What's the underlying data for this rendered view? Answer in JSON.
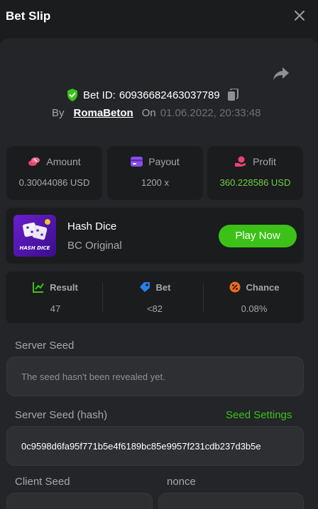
{
  "header": {
    "title": "Bet Slip",
    "close_icon": "close-icon"
  },
  "bet": {
    "id_label": "Bet ID:",
    "id": "60936682463037789",
    "by_label": "By",
    "username": "RomaBeton",
    "on_label": "On",
    "date": "01.06.2022, 20:33:48"
  },
  "stats": {
    "amount": {
      "label": "Amount",
      "value": "0.30044086 USD",
      "icon": "coins-icon"
    },
    "payout": {
      "label": "Payout",
      "value": "1200 x",
      "icon": "card-icon"
    },
    "profit": {
      "label": "Profit",
      "value": "360.228586 USD",
      "icon": "hand-coin-icon",
      "color": "#6fd13a"
    }
  },
  "game": {
    "name": "Hash Dice",
    "subtitle": "BC Original",
    "thumb_text": "HASH DICE",
    "play_label": "Play Now"
  },
  "result": {
    "result": {
      "label": "Result",
      "value": "47",
      "icon": "chart-icon",
      "color": "#3bc117"
    },
    "bet": {
      "label": "Bet",
      "value": "<82",
      "icon": "bet-tag-icon",
      "color": "#2b7de9"
    },
    "chance": {
      "label": "Chance",
      "value": "0.08%",
      "icon": "percent-icon",
      "color": "#f26a1b"
    }
  },
  "seeds": {
    "server_seed_label": "Server Seed",
    "server_seed_value": "The seed hasn't been revealed yet.",
    "server_hash_label": "Server Seed (hash)",
    "seed_settings_label": "Seed Settings",
    "server_hash_value": "0c9598d6fa95f771b5e4f6189bc85e9957f231cdb237d3b5e",
    "client_seed_label": "Client Seed",
    "nonce_label": "nonce"
  },
  "colors": {
    "accent": "#3bc117",
    "background": "#1b1c1e",
    "panel": "#232528"
  }
}
